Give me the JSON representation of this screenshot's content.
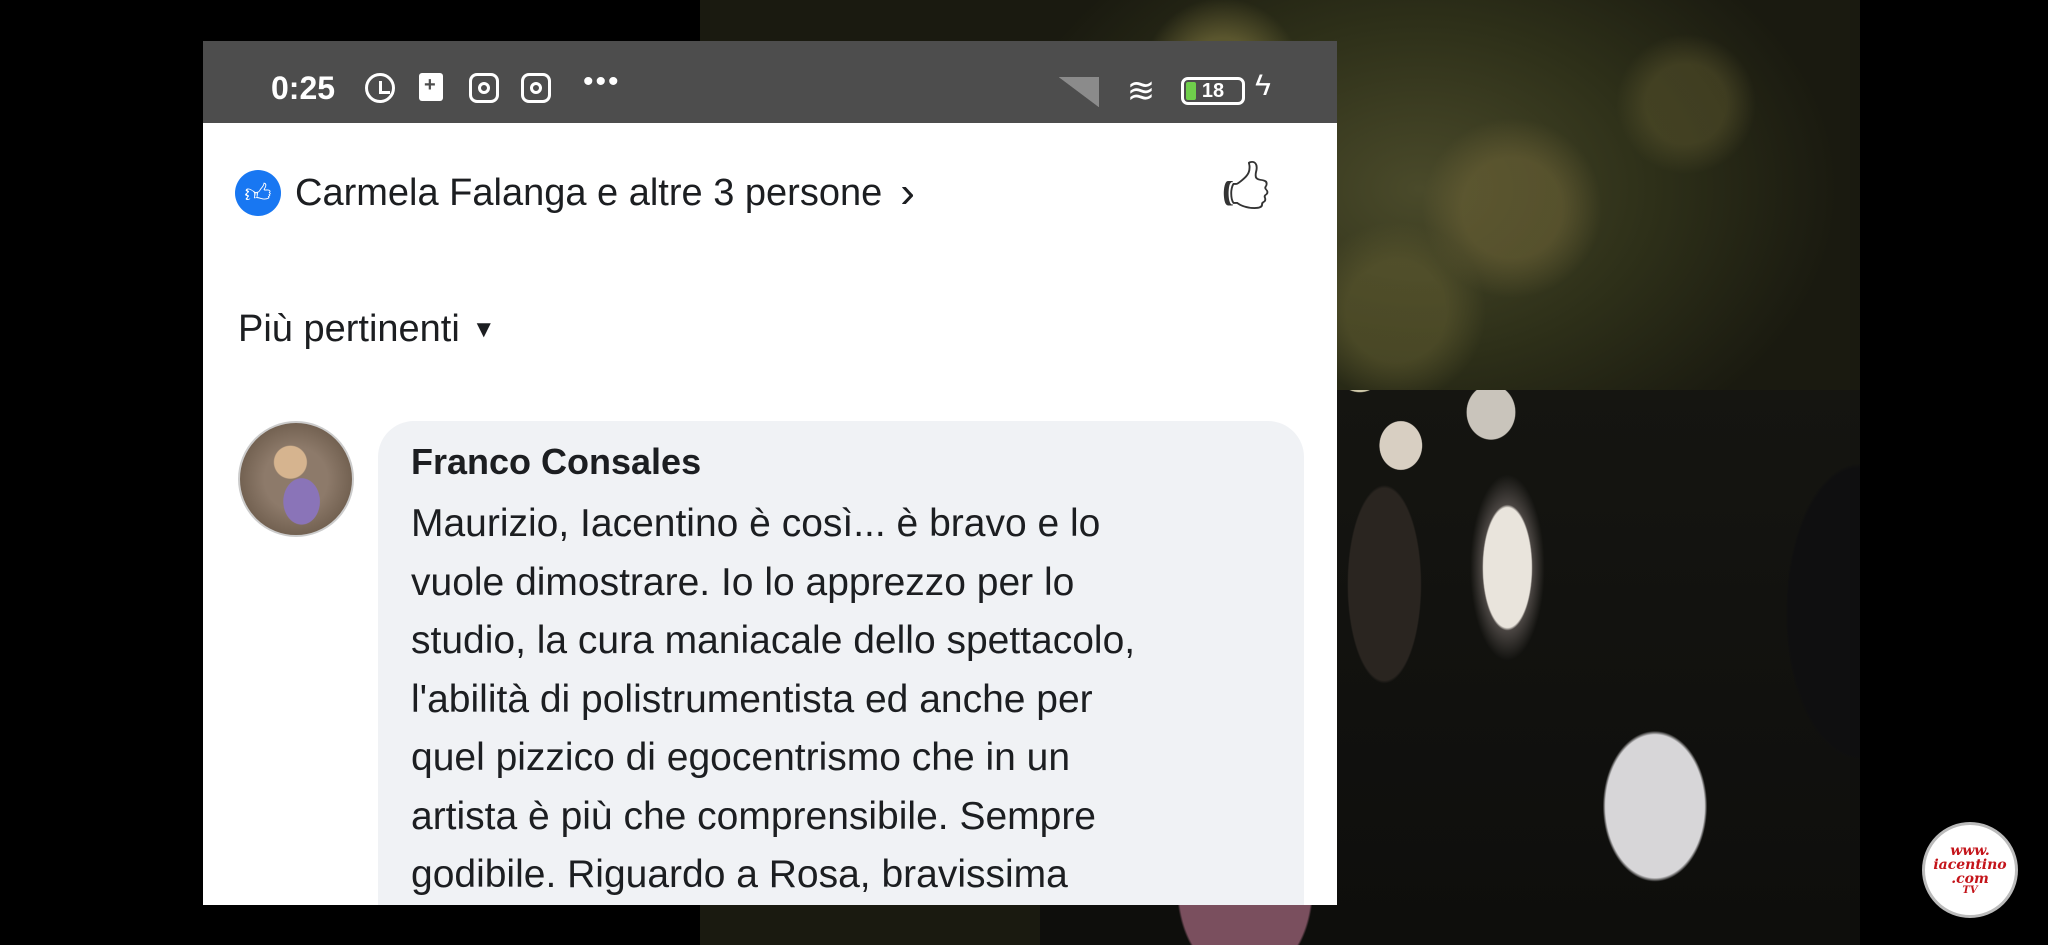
{
  "statusbar": {
    "time": "0:25",
    "battery_level": "18"
  },
  "post": {
    "reactions_text": "Carmela Falanga e altre 3 persone",
    "sort_label": "Più pertinenti"
  },
  "comment": {
    "author": "Franco Consales",
    "text": "Maurizio,  Iacentino è così... è bravo e lo\nvuole dimostrare. Io lo apprezzo per lo\nstudio, la cura maniacale dello spettacolo,\nl'abilità di polistrumentista ed anche per\nquel pizzico di egocentrismo che in un\nartista è più  che comprensibile. Sempre\ngodibile. Riguardo a Rosa, bravissima"
  },
  "watermark": {
    "line1": "www.",
    "line2": "iacentino",
    "line3": ".com",
    "line4": "TV"
  },
  "colors": {
    "statusbar_bg": "#4d4d4d",
    "like_blue": "#1877f2",
    "bubble_bg": "#f0f2f5",
    "watermark_red": "#c4141a"
  },
  "icons": [
    "alarm-icon",
    "battery-saver-icon",
    "instagram-icon",
    "more-icon",
    "signal-icon",
    "wifi-icon",
    "battery-icon",
    "charging-icon",
    "like-badge-icon",
    "chevron-right-icon",
    "like-icon",
    "chevron-down-icon"
  ]
}
